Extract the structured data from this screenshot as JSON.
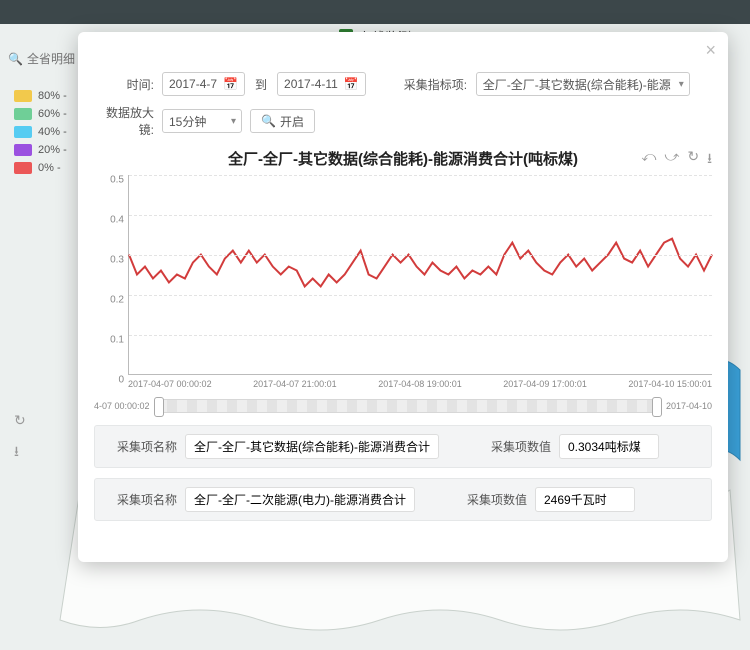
{
  "page": {
    "title": "在线监测"
  },
  "search": {
    "placeholder": "全省明细"
  },
  "legend": [
    {
      "label": "80% -",
      "color": "#f2c94c"
    },
    {
      "label": "60% -",
      "color": "#6fcf97"
    },
    {
      "label": "40% -",
      "color": "#56ccf2"
    },
    {
      "label": "20% -",
      "color": "#9b51e0"
    },
    {
      "label": "0% -",
      "color": "#eb5757"
    }
  ],
  "controls": {
    "time_label": "时间:",
    "date_from": "2017-4-7",
    "to_label": "到",
    "date_to": "2017-4-11",
    "metric_label": "采集指标项:",
    "metric_value": "全厂-全厂-其它数据(综合能耗)-能源",
    "zoom_label": "数据放大镜:",
    "zoom_value": "15分钟",
    "open_btn": "开启"
  },
  "chart_tools": {
    "a": "⤺",
    "b": "⤻",
    "c": "↻",
    "d": "⭳"
  },
  "slider": {
    "left_label": "4-07 00:00:02",
    "right_label": "2017-04-10"
  },
  "summary": {
    "name_label": "采集项名称",
    "value_label": "采集项数值",
    "rows": [
      {
        "name": "全厂-全厂-其它数据(综合能耗)-能源消费合计",
        "value": "0.3034吨标煤"
      },
      {
        "name": "全厂-全厂-二次能源(电力)-能源消费合计",
        "value": "2469千瓦时"
      }
    ]
  },
  "chart_data": {
    "type": "line",
    "title": "全厂-全厂-其它数据(综合能耗)-能源消费合计(吨标煤)",
    "xlabel": "",
    "ylabel": "",
    "ylim": [
      0,
      0.5
    ],
    "yticks": [
      0,
      0.1,
      0.2,
      0.3,
      0.4,
      0.5
    ],
    "x_tick_labels": [
      "2017-04-07 00:00:02",
      "2017-04-07 21:00:01",
      "2017-04-08 19:00:01",
      "2017-04-09 17:00:01",
      "2017-04-10 15:00:01"
    ],
    "series": [
      {
        "name": "能源消费合计",
        "color": "#d23c3c",
        "values": [
          0.3,
          0.25,
          0.27,
          0.24,
          0.26,
          0.23,
          0.25,
          0.24,
          0.28,
          0.3,
          0.27,
          0.25,
          0.29,
          0.31,
          0.28,
          0.31,
          0.28,
          0.3,
          0.27,
          0.25,
          0.27,
          0.26,
          0.22,
          0.24,
          0.22,
          0.25,
          0.23,
          0.25,
          0.28,
          0.31,
          0.25,
          0.24,
          0.27,
          0.3,
          0.28,
          0.3,
          0.27,
          0.25,
          0.28,
          0.26,
          0.25,
          0.27,
          0.24,
          0.26,
          0.25,
          0.27,
          0.25,
          0.3,
          0.33,
          0.29,
          0.31,
          0.28,
          0.26,
          0.25,
          0.28,
          0.3,
          0.27,
          0.29,
          0.26,
          0.28,
          0.3,
          0.33,
          0.29,
          0.28,
          0.31,
          0.27,
          0.3,
          0.33,
          0.34,
          0.29,
          0.27,
          0.3,
          0.26,
          0.3
        ]
      }
    ]
  }
}
